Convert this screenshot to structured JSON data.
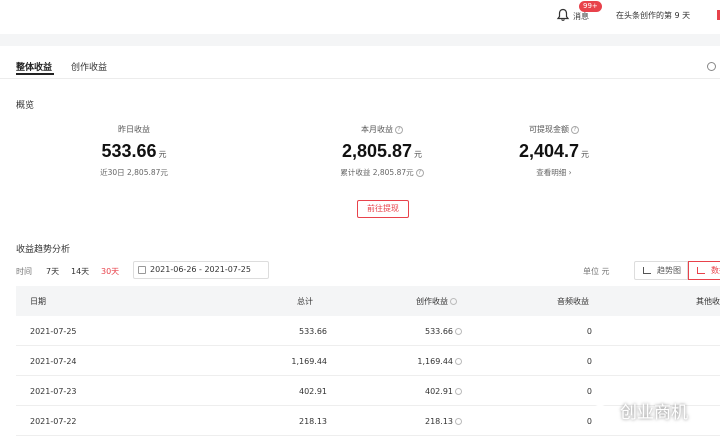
{
  "header": {
    "message_label": "消息",
    "message_badge": "99+",
    "days_text": "在头条创作的第 9 天"
  },
  "tabs": [
    {
      "label": "整体收益",
      "active": true
    },
    {
      "label": "创作收益",
      "active": false
    }
  ],
  "overview": {
    "title": "概览",
    "stats": [
      {
        "label": "昨日收益",
        "value": "533.66",
        "unit": "元",
        "sub": "近30日 2,805.87元"
      },
      {
        "label": "本月收益",
        "value": "2,805.87",
        "unit": "元",
        "sub": "累计收益 2,805.87元"
      },
      {
        "label": "可提现金额",
        "value": "2,404.7",
        "unit": "元",
        "sub": "查看明细 ›"
      }
    ],
    "withdraw_button": "前往提现"
  },
  "trend": {
    "title": "收益趋势分析",
    "time_label": "时间",
    "ranges": [
      "7天",
      "14天",
      "30天"
    ],
    "active_range": "30天",
    "date_range": "2021-06-26 - 2021-07-25",
    "unit_label": "单位   元",
    "view_trend": "趋势图",
    "view_data": "数据"
  },
  "table": {
    "columns": [
      "日期",
      "总计",
      "创作收益",
      "音频收益",
      "其他收"
    ],
    "rows": [
      [
        "2021-07-25",
        "533.66",
        "533.66",
        "0"
      ],
      [
        "2021-07-24",
        "1,169.44",
        "1,169.44",
        "0"
      ],
      [
        "2021-07-23",
        "402.91",
        "402.91",
        "0"
      ],
      [
        "2021-07-22",
        "218.13",
        "218.13",
        "0"
      ]
    ]
  },
  "watermark": "创业商机",
  "colors": {
    "accent": "#e8424b",
    "background": "#f4f5f6"
  }
}
